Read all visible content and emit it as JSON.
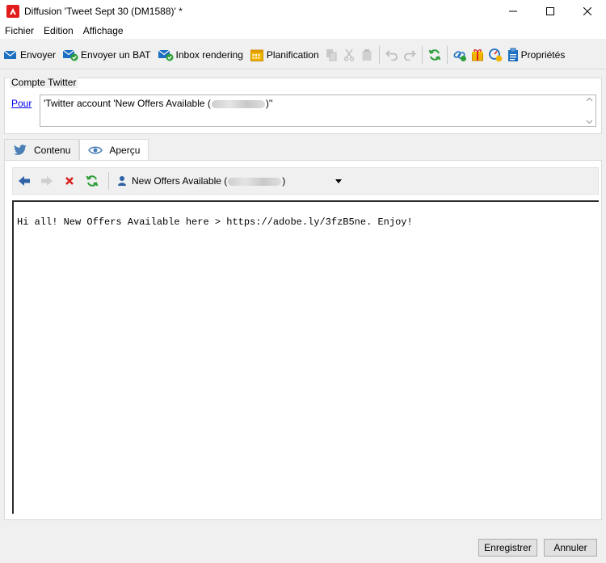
{
  "window": {
    "title": "Diffusion 'Tweet Sept 30 (DM1588)' *",
    "minimize_glyph": "—",
    "maximize_glyph": "☐",
    "close_glyph": "✕"
  },
  "menu": {
    "items": [
      {
        "label": "Fichier"
      },
      {
        "label": "Edition"
      },
      {
        "label": "Affichage"
      }
    ]
  },
  "toolbar": {
    "send_label": "Envoyer",
    "send_proof_label": "Envoyer un BAT",
    "inbox_rendering_label": "Inbox rendering",
    "schedule_label": "Planification",
    "properties_label": "Propriétés"
  },
  "twitter_account": {
    "group_title": "Compte Twitter",
    "to_link": "Pour",
    "recipient_prefix": "'Twitter account 'New Offers Available (",
    "recipient_suffix": ")''"
  },
  "tabs": [
    {
      "label": "Contenu",
      "icon": "twitter-bird-icon"
    },
    {
      "label": "Aperçu",
      "icon": "eye-icon"
    }
  ],
  "preview": {
    "account_prefix": "New Offers Available (",
    "account_suffix": ")",
    "message": "Hi all! New Offers Available here > https://adobe.ly/3fzB5ne. Enjoy!"
  },
  "footer": {
    "save_label": "Enregistrer",
    "cancel_label": "Annuler"
  },
  "colors": {
    "accent_blue": "#1d6fc1",
    "green_icon": "#2e9e3b",
    "red_icon": "#d92121",
    "calendar_yellow": "#f0b400"
  }
}
